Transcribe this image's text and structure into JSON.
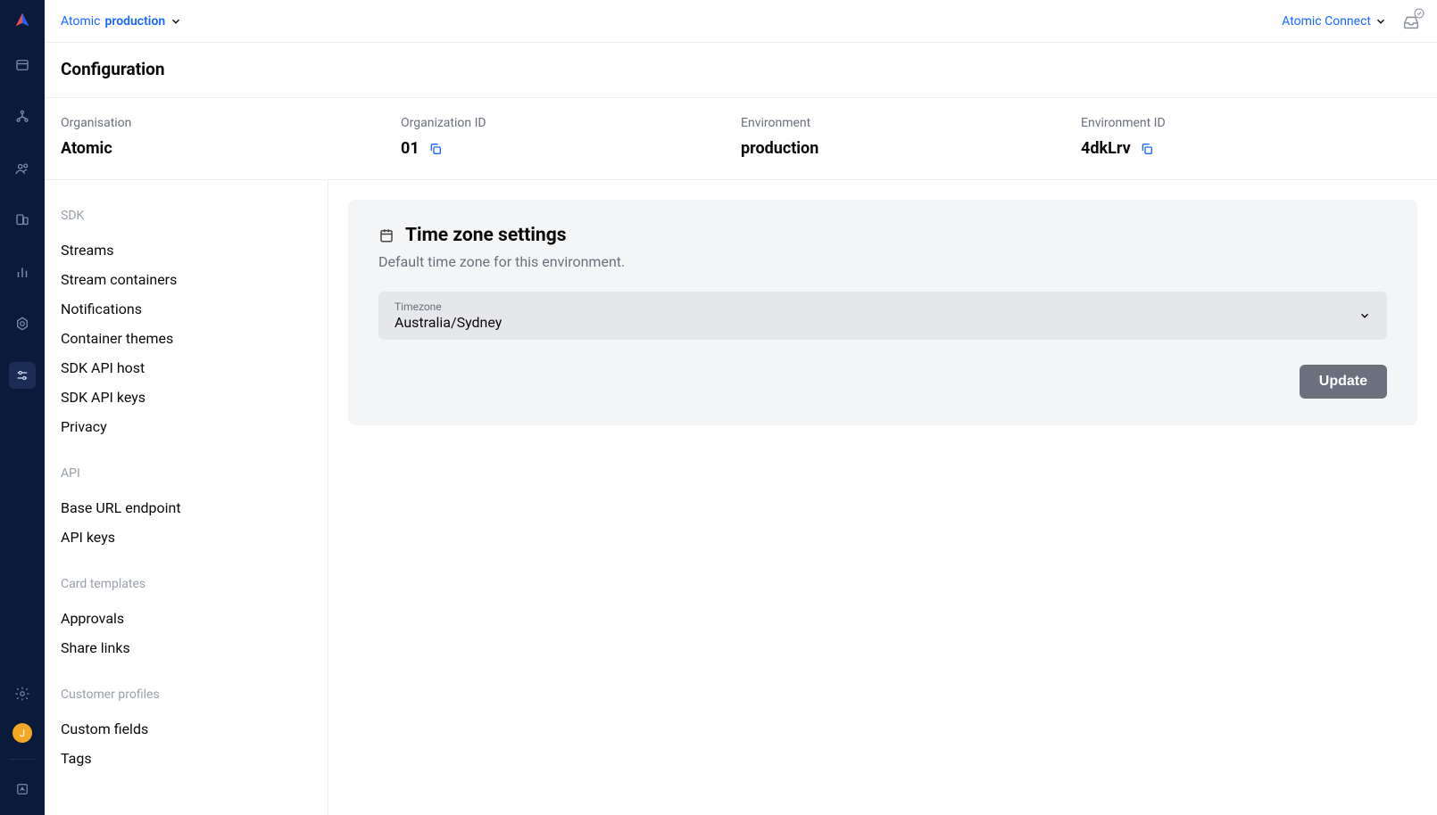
{
  "topbar": {
    "breadcrumb_org": "Atomic",
    "breadcrumb_env": "production",
    "connect_label": "Atomic Connect"
  },
  "page": {
    "title": "Configuration"
  },
  "info": {
    "org_label": "Organisation",
    "org_value": "Atomic",
    "org_id_label": "Organization ID",
    "org_id_value": "01",
    "env_label": "Environment",
    "env_value": "production",
    "env_id_label": "Environment ID",
    "env_id_value": "4dkLrv"
  },
  "sidebar": {
    "sections": [
      {
        "heading": "SDK",
        "items": [
          "Streams",
          "Stream containers",
          "Notifications",
          "Container themes",
          "SDK API host",
          "SDK API keys",
          "Privacy"
        ]
      },
      {
        "heading": "API",
        "items": [
          "Base URL endpoint",
          "API keys"
        ]
      },
      {
        "heading": "Card templates",
        "items": [
          "Approvals",
          "Share links"
        ]
      },
      {
        "heading": "Customer profiles",
        "items": [
          "Custom fields",
          "Tags"
        ]
      }
    ]
  },
  "panel": {
    "title": "Time zone settings",
    "subtitle": "Default time zone for this environment.",
    "field_label": "Timezone",
    "field_value": "Australia/Sydney",
    "update_label": "Update"
  },
  "avatar": {
    "initial": "J"
  }
}
